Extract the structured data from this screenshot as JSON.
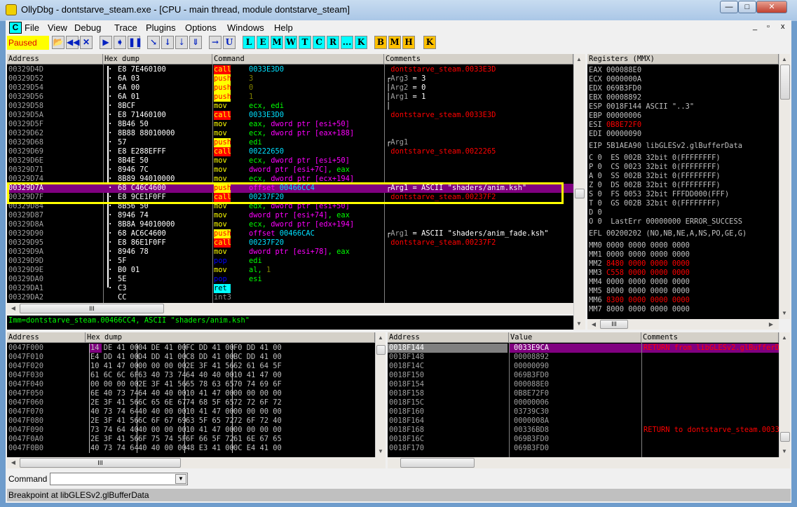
{
  "window": {
    "title": "OllyDbg - dontstarve_steam.exe - [CPU - main thread, module dontstarve_steam]",
    "min": "—",
    "max": "□",
    "close": "✕",
    "mdi_min": "_",
    "mdi_max": "▫",
    "mdi_close": "x"
  },
  "menu": {
    "app_icon": "C",
    "items": [
      "File",
      "View",
      "Debug",
      "Trace",
      "Plugins",
      "Options",
      "Windows",
      "Help"
    ]
  },
  "toolbar": {
    "status": "Paused",
    "buttons": [
      {
        "icon": "open-icon",
        "label": "📂"
      },
      {
        "icon": "restart-icon",
        "label": "◀◀"
      },
      {
        "icon": "close-icon",
        "label": "✕"
      },
      {
        "icon": "run-icon",
        "label": "▶"
      },
      {
        "icon": "step-icon",
        "label": "➧"
      },
      {
        "icon": "pause-icon",
        "label": "❚❚"
      },
      {
        "icon": "step-into-icon",
        "label": "↘"
      },
      {
        "icon": "step-over-icon",
        "label": "↓"
      },
      {
        "icon": "trace-into-icon",
        "label": "⇣"
      },
      {
        "icon": "trace-over-icon",
        "label": "⇓"
      },
      {
        "icon": "execute-till-return-icon",
        "label": "→"
      },
      {
        "icon": "user-code-icon",
        "label": "U"
      },
      {
        "label": "L",
        "c": "cy"
      },
      {
        "label": "E",
        "c": "cy"
      },
      {
        "label": "M",
        "c": "cy"
      },
      {
        "label": "W",
        "c": "cy"
      },
      {
        "label": "T",
        "c": "cy"
      },
      {
        "label": "C",
        "c": "cy"
      },
      {
        "label": "R",
        "c": "cy"
      },
      {
        "label": "...",
        "c": "cy"
      },
      {
        "label": "K",
        "c": "cy"
      },
      {
        "label": "B",
        "c": "or"
      },
      {
        "label": "M",
        "c": "or"
      },
      {
        "label": "H",
        "c": "or"
      },
      {
        "label": "K",
        "c": "or"
      }
    ]
  },
  "disasm": {
    "headers": [
      "Address",
      "Hex dump",
      "Command",
      "Comments"
    ],
    "rows": [
      {
        "a": "00329D4D",
        "h": "E8 7E460100",
        "m": "call",
        "o": [
          [
            "0033E3D0",
            "cy"
          ]
        ],
        "c": [
          [
            " dontstarve_steam.0033E3D",
            "rd"
          ]
        ]
      },
      {
        "a": "00329D52",
        "h": "6A 03",
        "m": "push",
        "o": [
          [
            "3",
            "ol"
          ]
        ],
        "c": [
          [
            "┌",
            "wh"
          ],
          [
            "Arg3",
            "gy"
          ],
          [
            " = 3",
            "wh"
          ]
        ]
      },
      {
        "a": "00329D54",
        "h": "6A 00",
        "m": "push",
        "o": [
          [
            "0",
            "ol"
          ]
        ],
        "c": [
          [
            "│",
            "wh"
          ],
          [
            "Arg2",
            "gy"
          ],
          [
            " = 0",
            "wh"
          ]
        ]
      },
      {
        "a": "00329D56",
        "h": "6A 01",
        "m": "push",
        "o": [
          [
            "1",
            "ol"
          ]
        ],
        "c": [
          [
            "│",
            "wh"
          ],
          [
            "Arg1",
            "gy"
          ],
          [
            " = 1",
            "wh"
          ]
        ]
      },
      {
        "a": "00329D58",
        "h": "8BCF",
        "m": "mov",
        "o": [
          [
            "ecx, edi",
            "gr"
          ]
        ],
        "c": [
          [
            "│",
            "wh"
          ]
        ]
      },
      {
        "a": "00329D5A",
        "h": "E8 71460100",
        "m": "call",
        "o": [
          [
            "0033E3D0",
            "cy"
          ]
        ],
        "c": [
          [
            " dontstarve_steam.0033E3D",
            "rd"
          ]
        ]
      },
      {
        "a": "00329D5F",
        "h": "8B46 50",
        "m": "mov",
        "o": [
          [
            "eax, ",
            "gr"
          ],
          [
            "dword ptr [esi+50]",
            "mg"
          ]
        ],
        "c": []
      },
      {
        "a": "00329D62",
        "h": "8B88 88010000",
        "m": "mov",
        "o": [
          [
            "ecx, ",
            "gr"
          ],
          [
            "dword ptr [eax+188]",
            "mg"
          ]
        ],
        "c": []
      },
      {
        "a": "00329D68",
        "h": "57",
        "m": "push",
        "o": [
          [
            "edi",
            "gr"
          ]
        ],
        "c": [
          [
            "┌",
            "wh"
          ],
          [
            "Arg1",
            "gy"
          ]
        ]
      },
      {
        "a": "00329D69",
        "h": "E8 E288EFFF",
        "m": "call",
        "o": [
          [
            "00222650",
            "cy"
          ]
        ],
        "c": [
          [
            " dontstarve_steam.0022265",
            "rd"
          ]
        ]
      },
      {
        "a": "00329D6E",
        "h": "8B4E 50",
        "m": "mov",
        "o": [
          [
            "ecx, ",
            "gr"
          ],
          [
            "dword ptr [esi+50]",
            "mg"
          ]
        ],
        "c": []
      },
      {
        "a": "00329D71",
        "h": "8946 7C",
        "m": "mov",
        "o": [
          [
            "dword ptr [esi+7C]",
            "mg"
          ],
          [
            ", eax",
            "gr"
          ]
        ],
        "c": []
      },
      {
        "a": "00329D74",
        "h": "8B89 94010000",
        "m": "mov",
        "o": [
          [
            "ecx, ",
            "gr"
          ],
          [
            "dword ptr [ecx+194]",
            "mg"
          ]
        ],
        "c": []
      },
      {
        "a": "00329D7A",
        "h": "68 C46C4600",
        "m": "push",
        "o": [
          [
            "offset ",
            "mg"
          ],
          [
            "00466CC4",
            "cy"
          ]
        ],
        "c": [
          [
            "┌",
            "wh"
          ],
          [
            "Arg1 = ASCII \"shaders/anim.ksh\"",
            "wh"
          ]
        ],
        "sel": true
      },
      {
        "a": "00329D7F",
        "h": "E8 9CE1F0FF",
        "m": "call",
        "o": [
          [
            "00237F20",
            "cy"
          ]
        ],
        "c": [
          [
            " dontstarve_steam.00237F2",
            "rd"
          ]
        ]
      },
      {
        "a": "00329D84",
        "h": "8B56 50",
        "m": "mov",
        "o": [
          [
            "edx, ",
            "gr"
          ],
          [
            "dword ptr [esi+50]",
            "mg"
          ]
        ],
        "c": []
      },
      {
        "a": "00329D87",
        "h": "8946 74",
        "m": "mov",
        "o": [
          [
            "dword ptr [esi+74]",
            "mg"
          ],
          [
            ", eax",
            "gr"
          ]
        ],
        "c": []
      },
      {
        "a": "00329D8A",
        "h": "8B8A 94010000",
        "m": "mov",
        "o": [
          [
            "ecx, ",
            "gr"
          ],
          [
            "dword ptr [edx+194]",
            "mg"
          ]
        ],
        "c": []
      },
      {
        "a": "00329D90",
        "h": "68 AC6C4600",
        "m": "push",
        "o": [
          [
            "offset ",
            "mg"
          ],
          [
            "00466CAC",
            "cy"
          ]
        ],
        "c": [
          [
            "┌",
            "wh"
          ],
          [
            "Arg1",
            "gy"
          ],
          [
            " = ASCII \"shaders/anim_fade.ksh\"",
            "wh"
          ]
        ]
      },
      {
        "a": "00329D95",
        "h": "E8 86E1F0FF",
        "m": "call",
        "o": [
          [
            "00237F20",
            "cy"
          ]
        ],
        "c": [
          [
            " dontstarve_steam.00237F2",
            "rd"
          ]
        ]
      },
      {
        "a": "00329D9A",
        "h": "8946 78",
        "m": "mov",
        "o": [
          [
            "dword ptr [esi+78]",
            "mg"
          ],
          [
            ", eax",
            "gr"
          ]
        ],
        "c": []
      },
      {
        "a": "00329D9D",
        "h": "5F",
        "m": "pop",
        "o": [
          [
            "edi",
            "gr"
          ]
        ],
        "c": []
      },
      {
        "a": "00329D9E",
        "h": "B0 01",
        "m": "mov",
        "o": [
          [
            "al, ",
            "gr"
          ],
          [
            "1",
            "ol"
          ]
        ],
        "c": []
      },
      {
        "a": "00329DA0",
        "h": "5E",
        "m": "pop",
        "o": [
          [
            "esi",
            "gr"
          ]
        ],
        "c": []
      },
      {
        "a": "00329DA1",
        "h": "C3",
        "m": "ret",
        "o": [],
        "c": []
      },
      {
        "a": "00329DA2",
        "h": "CC",
        "m": "int3",
        "o": [],
        "c": [],
        "nodot": true
      }
    ],
    "info": "Imm=dontstarve_steam.00466CC4, ASCII \"shaders/anim.ksh\""
  },
  "registers": {
    "header": "Registers (MMX)",
    "lines": [
      [
        [
          "EAX 000088E0",
          "lg"
        ]
      ],
      [
        [
          "ECX 0000000A",
          "lg"
        ]
      ],
      [
        [
          "EDX 069B3FD0",
          "lg"
        ]
      ],
      [
        [
          "EBX 00008892",
          "lg"
        ]
      ],
      [
        [
          "ESP 0018F144 ASCII \"..3\"",
          "lg"
        ]
      ],
      [
        [
          "EBP 00000006",
          "lg"
        ]
      ],
      [
        [
          "ESI ",
          "lg"
        ],
        [
          "0B8E72F0",
          "rd"
        ]
      ],
      [
        [
          "EDI 00000090",
          "lg"
        ]
      ],
      [
        [
          "",
          "lg"
        ]
      ],
      [
        [
          "EIP 5B1AEA90 libGLESv2.glBufferData",
          "lg"
        ]
      ],
      [
        [
          "",
          "lg"
        ]
      ],
      [
        [
          "C 0  ES 002B 32bit 0(FFFFFFFF)",
          "lg"
        ]
      ],
      [
        [
          "P 0  CS 0023 32bit 0(FFFFFFFF)",
          "lg"
        ]
      ],
      [
        [
          "A 0  SS 002B 32bit 0(FFFFFFFF)",
          "lg"
        ]
      ],
      [
        [
          "Z 0  DS 002B 32bit 0(FFFFFFFF)",
          "lg"
        ]
      ],
      [
        [
          "S 0  FS 0053 32bit FFFDD000(FFF)",
          "lg"
        ]
      ],
      [
        [
          "T 0  GS 002B 32bit 0(FFFFFFFF)",
          "lg"
        ]
      ],
      [
        [
          "D 0",
          "lg"
        ]
      ],
      [
        [
          "O 0  LastErr 00000000 ERROR_SUCCESS",
          "lg"
        ]
      ],
      [
        [
          "",
          "lg"
        ]
      ],
      [
        [
          "EFL 00200202 (NO,NB,NE,A,NS,PO,GE,G)",
          "lg"
        ]
      ],
      [
        [
          "",
          "lg"
        ]
      ],
      [
        [
          "MM0 0000 0000 0000 0000",
          "lg"
        ]
      ],
      [
        [
          "MM1 0000 0000 0000 0000",
          "lg"
        ]
      ],
      [
        [
          "MM2 ",
          "lg"
        ],
        [
          "8480 0000 0000 0000",
          "rd"
        ]
      ],
      [
        [
          "MM3 ",
          "lg"
        ],
        [
          "C558 0000 0000 0000",
          "rd"
        ]
      ],
      [
        [
          "MM4 0000 0000 0000 0000",
          "lg"
        ]
      ],
      [
        [
          "MM5 8000 0000 0000 0000",
          "lg"
        ]
      ],
      [
        [
          "MM6 ",
          "lg"
        ],
        [
          "8300 0000 0000 0000",
          "rd"
        ]
      ],
      [
        [
          "MM7 8000 0000 0000 0000",
          "lg"
        ]
      ]
    ]
  },
  "dump": {
    "headers": [
      "Address",
      "Hex dump"
    ],
    "rows": [
      [
        "0047F000",
        "14 DE 41 00",
        "04 DE 41 00",
        "FC DD 41 00",
        "F0 DD 41 00"
      ],
      [
        "0047F010",
        "E4 DD 41 00",
        "D4 DD 41 00",
        "C8 DD 41 00",
        "BC DD 41 00"
      ],
      [
        "0047F020",
        "10 41 47 00",
        "00 00 00 00",
        "2E 3F 41 56",
        "62 61 64 5F"
      ],
      [
        "0047F030",
        "61 6C 6C 6F",
        "63 40 73 74",
        "64 40 40 00",
        "10 41 47 00"
      ],
      [
        "0047F040",
        "00 00 00 00",
        "2E 3F 41 56",
        "65 78 63 65",
        "70 74 69 6F"
      ],
      [
        "0047F050",
        "6E 40 73 74",
        "64 40 40 00",
        "10 41 47 00",
        "00 00 00 00"
      ],
      [
        "0047F060",
        "2E 3F 41 56",
        "6C 65 6E 67",
        "74 68 5F 65",
        "72 72 6F 72"
      ],
      [
        "0047F070",
        "40 73 74 64",
        "40 40 00 00",
        "10 41 47 00",
        "00 00 00 00"
      ],
      [
        "0047F080",
        "2E 3F 41 56",
        "6C 6F 67 69",
        "63 5F 65 72",
        "72 6F 72 40"
      ],
      [
        "0047F090",
        "73 74 64 40",
        "40 00 00 00",
        "10 41 47 00",
        "00 00 00 00"
      ],
      [
        "0047F0A0",
        "2E 3F 41 56",
        "6F 75 74 5F",
        "6F 66 5F 72",
        "61 6E 67 65"
      ],
      [
        "0047F0B0",
        "40 73 74 64",
        "40 40 00 00",
        "48 E3 41 00",
        "0C E4 41 00"
      ]
    ]
  },
  "stack": {
    "headers": [
      "Address",
      "Value",
      "Comments"
    ],
    "rows": [
      [
        "0018F144",
        "0033E9CA",
        "RETURN from libGLESv2.glBufferDa"
      ],
      [
        "0018F148",
        "00008892",
        ""
      ],
      [
        "0018F14C",
        "00000090",
        ""
      ],
      [
        "0018F150",
        "069B3FD0",
        ""
      ],
      [
        "0018F154",
        "000088E0",
        ""
      ],
      [
        "0018F158",
        "0B8E72F0",
        ""
      ],
      [
        "0018F15C",
        "00000006",
        ""
      ],
      [
        "0018F160",
        "03739C30",
        ""
      ],
      [
        "0018F164",
        "0000008A",
        ""
      ],
      [
        "0018F168",
        "00336BD8",
        "RETURN to dontstarve_steam.00336"
      ],
      [
        "0018F16C",
        "069B3FD0",
        ""
      ],
      [
        "0018F170",
        "069B3FD0",
        ""
      ]
    ]
  },
  "command": {
    "label": "Command :",
    "value": ""
  },
  "status": "Breakpoint at libGLESv2.glBufferData"
}
